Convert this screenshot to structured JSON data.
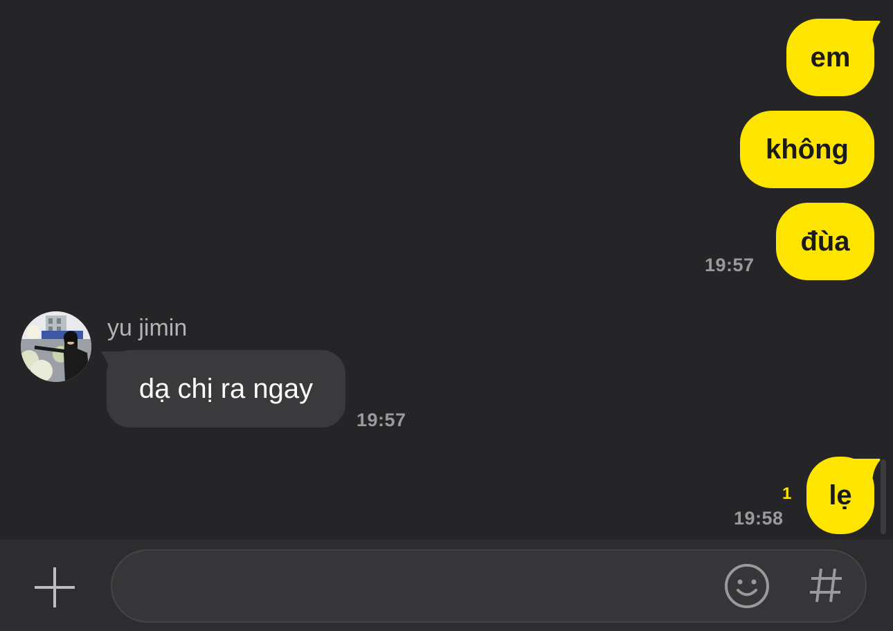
{
  "messages": [
    {
      "sender": "me",
      "text": "em"
    },
    {
      "sender": "me",
      "text": "không"
    },
    {
      "sender": "me",
      "text": "đùa",
      "time": "19:57"
    },
    {
      "sender": "other",
      "name": "yu jimin",
      "text": "dạ chị ra ngay",
      "time": "19:57",
      "avatar_icon": "profile-photo"
    },
    {
      "sender": "me",
      "text": "lẹ",
      "time": "19:58",
      "unread_count": "1"
    }
  ],
  "input": {
    "value": "",
    "placeholder": ""
  },
  "icons": {
    "attach": "plus-icon",
    "emoji": "smiley-icon",
    "hashtag": "hash-icon"
  },
  "colors": {
    "background": "#252527",
    "my_bubble": "#FEE500",
    "other_bubble": "#3a3a3c",
    "timestamp": "#9a9a9c",
    "unread": "#FEE500"
  }
}
